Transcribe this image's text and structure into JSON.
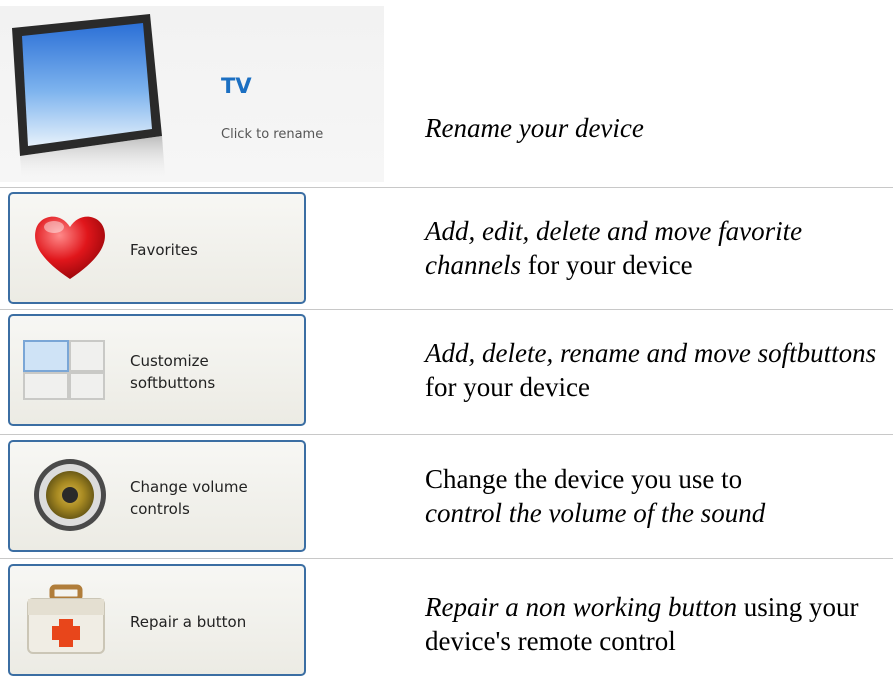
{
  "device": {
    "name": "TV",
    "rename_hint": "Click to rename",
    "description": "Rename your device"
  },
  "actions": [
    {
      "label_lines": [
        "Favorites"
      ],
      "icon": "heart-icon",
      "desc_italic": "Add, edit, delete and move favorite channels",
      "desc_rest": " for your device"
    },
    {
      "label_lines": [
        "Customize",
        "softbuttons"
      ],
      "icon": "softbuttons-grid-icon",
      "desc_italic": "Add, delete, rename and move softbuttons",
      "desc_rest": " for your device"
    },
    {
      "label_lines": [
        "Change volume",
        "controls"
      ],
      "icon": "speaker-icon",
      "desc_plain": "Change the device you use to",
      "desc_italic": "control the volume of the sound"
    },
    {
      "label_lines": [
        "Repair a button"
      ],
      "icon": "toolbox-icon",
      "desc_italic": "Repair a non working button",
      "desc_rest": " using your device's remote control"
    }
  ],
  "colors": {
    "button_border": "#3b6ea3",
    "device_name": "#1b6fc2",
    "divider": "#c8c8c8"
  }
}
